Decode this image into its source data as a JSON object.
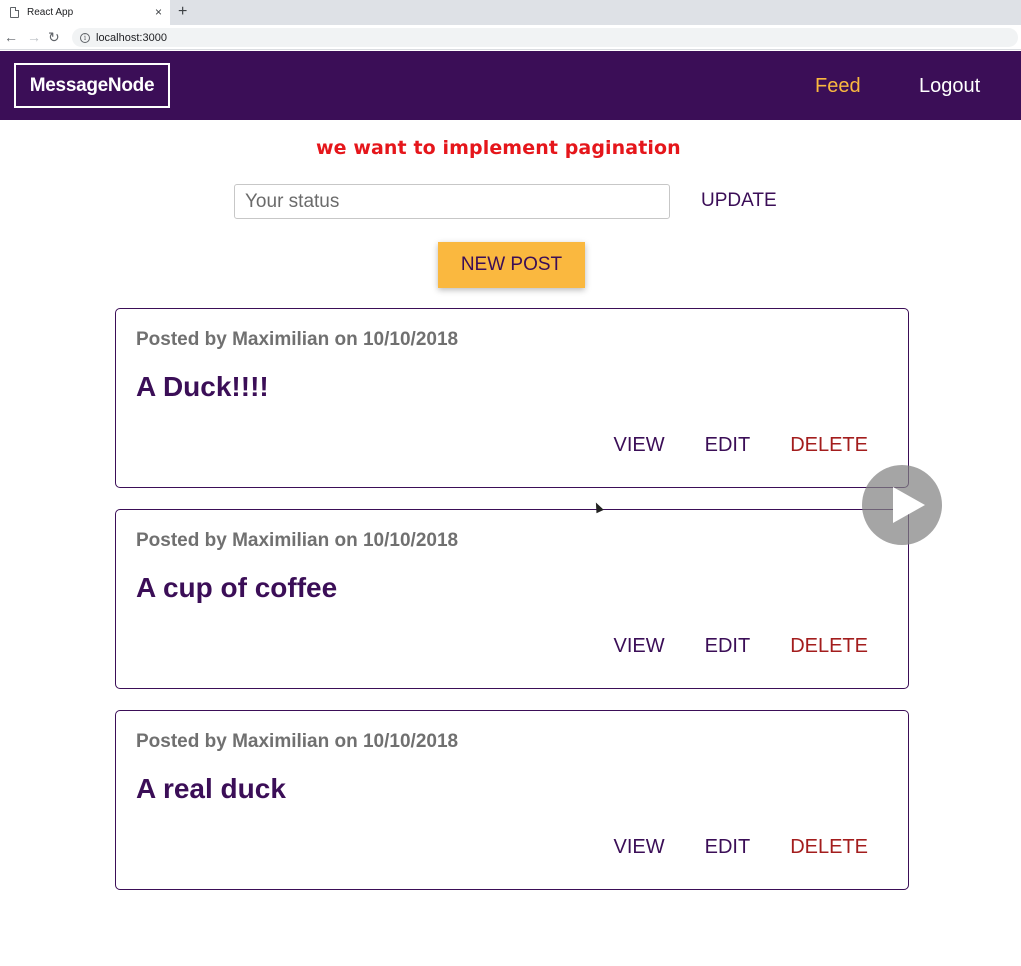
{
  "browser": {
    "tab_title": "React App",
    "tab_close": "×",
    "new_tab": "+",
    "url": "localhost:3000",
    "back": "←",
    "forward": "→",
    "reload": "↻",
    "info": "i"
  },
  "header": {
    "logo": "MessageNode",
    "nav": {
      "feed": "Feed",
      "logout": "Logout"
    }
  },
  "annotation": "we want to implement pagination",
  "status": {
    "placeholder": "Your status",
    "value": "",
    "update_label": "UPDATE"
  },
  "new_post_label": "NEW POST",
  "posts": [
    {
      "meta": "Posted by Maximilian on 10/10/2018",
      "title": "A Duck!!!!"
    },
    {
      "meta": "Posted by Maximilian on 10/10/2018",
      "title": "A cup of coffee"
    },
    {
      "meta": "Posted by Maximilian on 10/10/2018",
      "title": "A real duck"
    }
  ],
  "post_actions": {
    "view": "VIEW",
    "edit": "EDIT",
    "delete": "DELETE"
  },
  "colors": {
    "brand": "#3b0e57",
    "accent": "#fab83f",
    "danger": "#a31d1d",
    "annotation": "#e5161b"
  }
}
